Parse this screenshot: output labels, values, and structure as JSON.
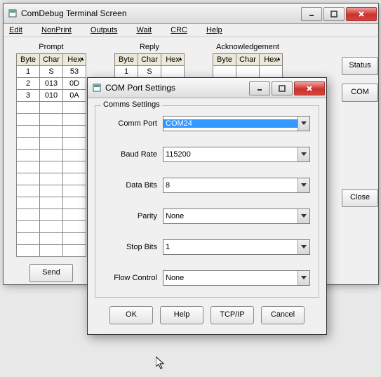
{
  "mainWindow": {
    "title": "ComDebug Terminal Screen",
    "menu": {
      "edit": "Edit",
      "nonprint": "NonPrint",
      "outputs": "Outputs",
      "wait": "Wait",
      "crc": "CRC",
      "help": "Help"
    },
    "sections": {
      "prompt": "Prompt",
      "reply": "Reply",
      "ack": "Acknowledgement"
    },
    "headers": {
      "byte": "Byte",
      "char": "Char",
      "hex": "Hex"
    },
    "promptRows": [
      {
        "byte": "1",
        "char": "S",
        "hex": "53"
      },
      {
        "byte": "2",
        "char": "013",
        "hex": "0D"
      },
      {
        "byte": "3",
        "char": "010",
        "hex": "0A"
      }
    ],
    "replyRows": [
      {
        "byte": "1",
        "char": "S",
        "hex": ""
      }
    ],
    "ackRows": [],
    "buttons": {
      "status": "Status",
      "com": "COM",
      "close": "Close",
      "send": "Send"
    }
  },
  "dialog": {
    "title": "COM Port Settings",
    "group": "Comms Settings",
    "fields": {
      "commPort": {
        "label": "Comm Port",
        "value": "COM24"
      },
      "baudRate": {
        "label": "Baud Rate",
        "value": "115200"
      },
      "dataBits": {
        "label": "Data Bits",
        "value": "8"
      },
      "parity": {
        "label": "Parity",
        "value": "None"
      },
      "stopBits": {
        "label": "Stop Bits",
        "value": "1"
      },
      "flowCtrl": {
        "label": "Flow Control",
        "value": "None"
      }
    },
    "buttons": {
      "ok": "OK",
      "help": "Help",
      "tcpip": "TCP/IP",
      "cancel": "Cancel"
    }
  }
}
